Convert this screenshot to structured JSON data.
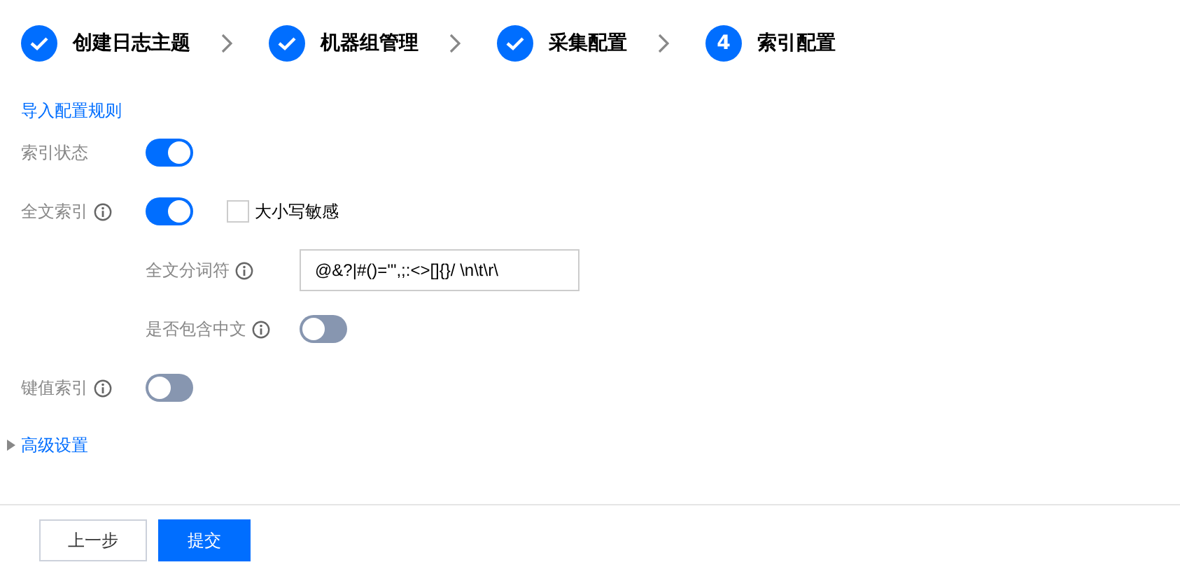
{
  "steps": [
    {
      "label": "创建日志主题",
      "done": true
    },
    {
      "label": "机器组管理",
      "done": true
    },
    {
      "label": "采集配置",
      "done": true
    },
    {
      "label": "索引配置",
      "done": false,
      "number": "4"
    }
  ],
  "import_link": "导入配置规则",
  "fields": [
    {
      "kind": "toggle",
      "label": "索引状态",
      "info": false,
      "on": true
    },
    {
      "kind": "toggle",
      "label": "全文索引",
      "info": true,
      "on": true,
      "checkbox": {
        "label": "大小写敏感",
        "checked": false
      },
      "children": [
        {
          "kind": "input",
          "label": "全文分词符",
          "info": true,
          "value": "@&?|#()='\",;:<>[]{}/ \\n\\t\\r\\"
        },
        {
          "kind": "toggle",
          "label": "是否包含中文",
          "info": true,
          "on": false
        }
      ]
    },
    {
      "kind": "toggle",
      "label": "键值索引",
      "info": true,
      "on": false
    }
  ],
  "advanced": {
    "label": "高级设置",
    "expanded": false
  },
  "buttons": [
    {
      "label": "上一步",
      "kind": "secondary"
    },
    {
      "label": "提交",
      "kind": "primary"
    }
  ]
}
